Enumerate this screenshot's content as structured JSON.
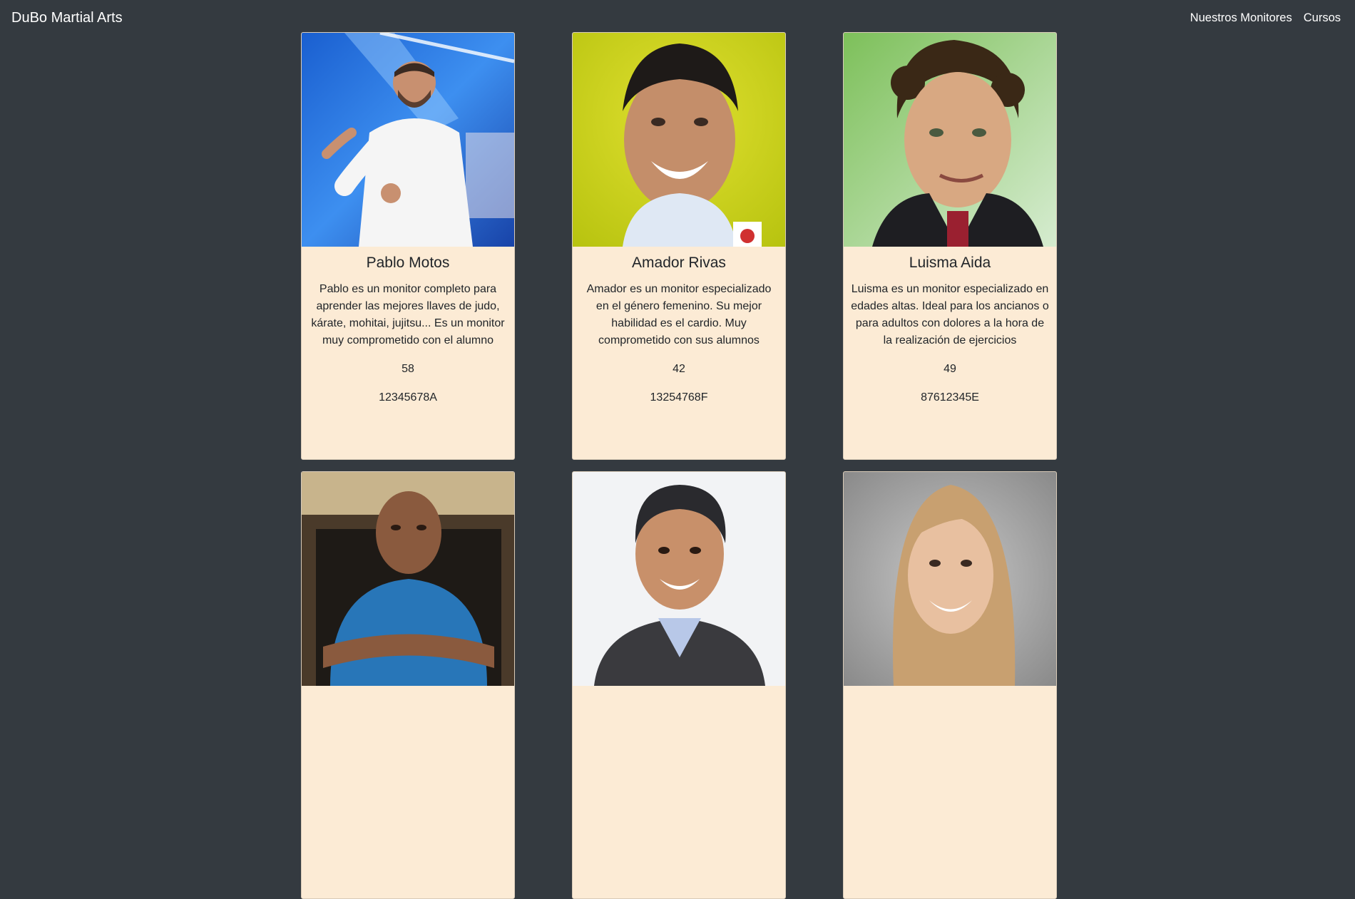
{
  "navbar": {
    "brand": "DuBo Martial Arts",
    "links": [
      "Nuestros Monitores",
      "Cursos"
    ]
  },
  "monitors": [
    {
      "name": "Pablo Motos",
      "description": "Pablo es un monitor completo para aprender las mejores llaves de judo, kárate, mohitai, jujitsu... Es un monitor muy comprometido con el alumno",
      "age": "58",
      "dni": "12345678A"
    },
    {
      "name": "Amador Rivas",
      "description": "Amador es un monitor especializado en el género femenino. Su mejor habilidad es el cardio. Muy comprometido con sus alumnos",
      "age": "42",
      "dni": "13254768F"
    },
    {
      "name": "Luisma Aida",
      "description": "Luisma es un monitor especializado en edades altas. Ideal para los ancianos o para adultos con dolores a la hora de la realización de ejercicios",
      "age": "49",
      "dni": "87612345E"
    },
    {
      "name": "",
      "description": "",
      "age": "",
      "dni": ""
    },
    {
      "name": "",
      "description": "",
      "age": "",
      "dni": ""
    },
    {
      "name": "",
      "description": "",
      "age": "",
      "dni": ""
    }
  ],
  "colors": {
    "page_bg": "#343a40",
    "card_bg": "#fcebd5",
    "nav_text": "#ffffff"
  }
}
